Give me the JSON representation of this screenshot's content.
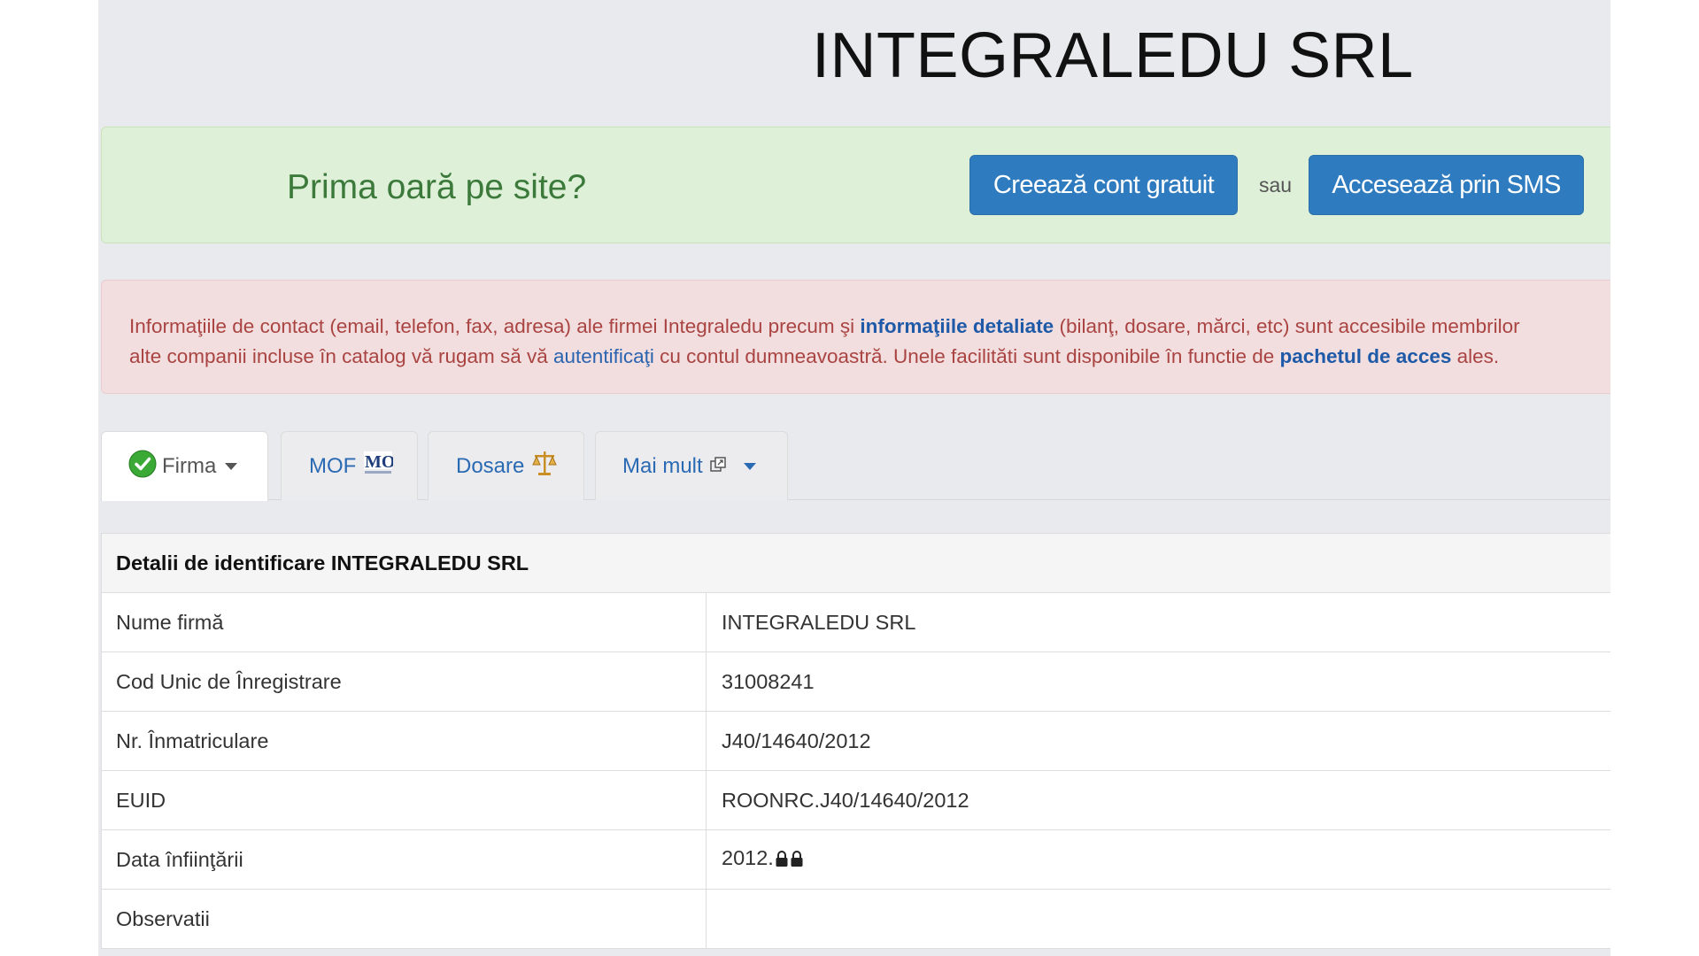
{
  "company_title": "INTEGRALEDU SRL",
  "promo": {
    "text": "Prima oară pe site?",
    "create_button": "Creează cont gratuit",
    "or": "sau",
    "sms_button": "Accesează prin SMS"
  },
  "alert": {
    "part1": "Informaţiile de contact (email, telefon, fax, adresa) ale firmei Integraledu precum şi ",
    "link1": "informaţiile detaliate",
    "part2": " (bilanţ, dosare, mărci, etc) sunt accesibile membrilor",
    "part3": "alte companii incluse în catalog vă rugam să vă ",
    "link2": "autentificaţi",
    "part4": " cu contul dumneavoastră. Unele facilităti sunt disponibile în functie de ",
    "link3": "pachetul de acces",
    "part5": " ales."
  },
  "tabs": [
    {
      "label": "Firma",
      "icon": "check-circle-icon",
      "active": true
    },
    {
      "label": "MOF",
      "icon": "mo-logo-icon"
    },
    {
      "label": "Dosare",
      "icon": "scales-icon"
    },
    {
      "label": "Mai mult",
      "icon": "external-link-icon"
    }
  ],
  "details": {
    "header": "Detalii de identificare INTEGRALEDU SRL",
    "rows": [
      {
        "label": "Nume firmă",
        "value": "INTEGRALEDU SRL"
      },
      {
        "label": "Cod Unic de Înregistrare",
        "value": "31008241"
      },
      {
        "label": "Nr. Înmatriculare",
        "value": "J40/14640/2012"
      },
      {
        "label": "EUID",
        "value": "ROONRC.J40/14640/2012"
      },
      {
        "label": "Data înfiinţării",
        "value": "2012."
      },
      {
        "label": "Observatii",
        "value": ""
      }
    ]
  },
  "colors": {
    "primary_button": "#2f7bbf",
    "promo_bg": "#dff0d8",
    "alert_bg": "#f2dede",
    "alert_text": "#a94442",
    "link": "#2a64b0"
  }
}
